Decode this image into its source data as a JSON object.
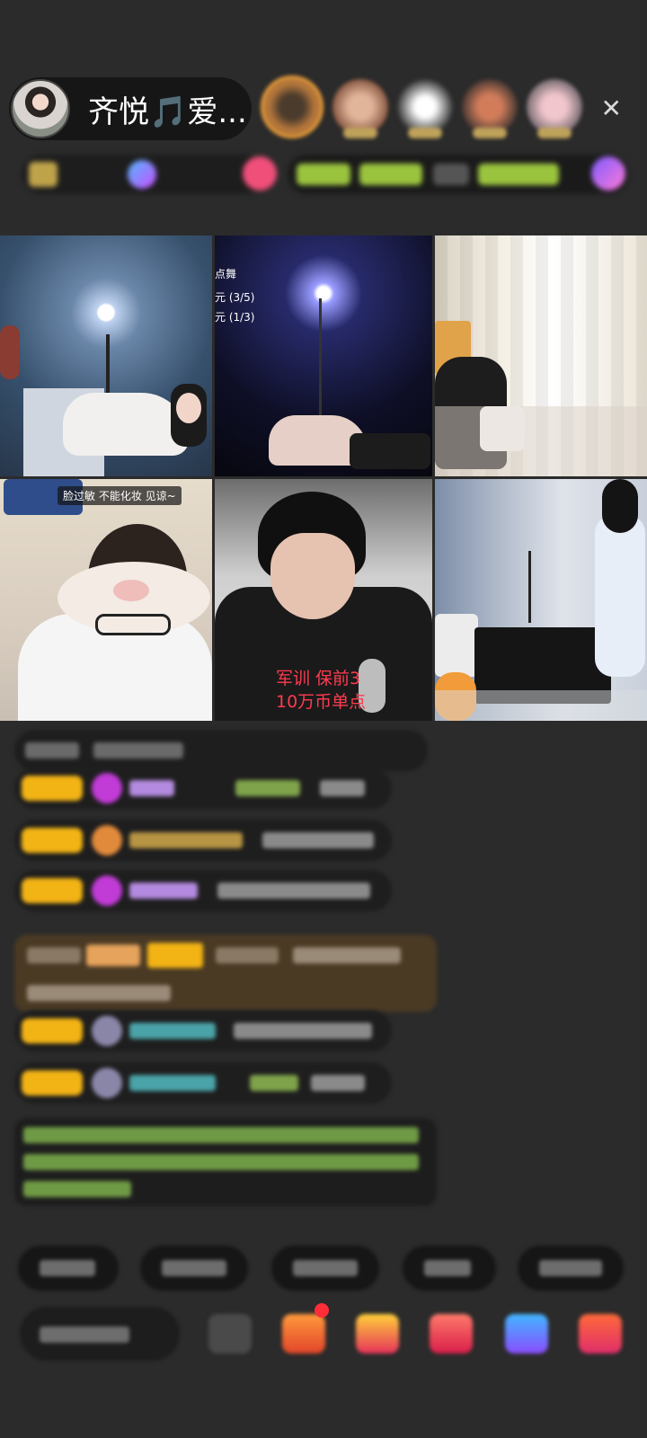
{
  "header": {
    "host_name": "齐悦🎵爱...",
    "close_symbol": "✕"
  },
  "video_tiles": {
    "tile2_overlay": {
      "line1": "点舞",
      "line2": "元 (3/5)",
      "line3": "元 (1/3)"
    },
    "tile4_sticker": "脸过敏 不能化妆 见谅~",
    "tile5_caption": {
      "line1": "军训 保前3",
      "line2": "10万币单点"
    }
  },
  "colors": {
    "background": "#2b2b2b",
    "level_badge": "#f2b315",
    "caption_red": "#ff3b4f",
    "green_text": "#8ccf5a"
  }
}
